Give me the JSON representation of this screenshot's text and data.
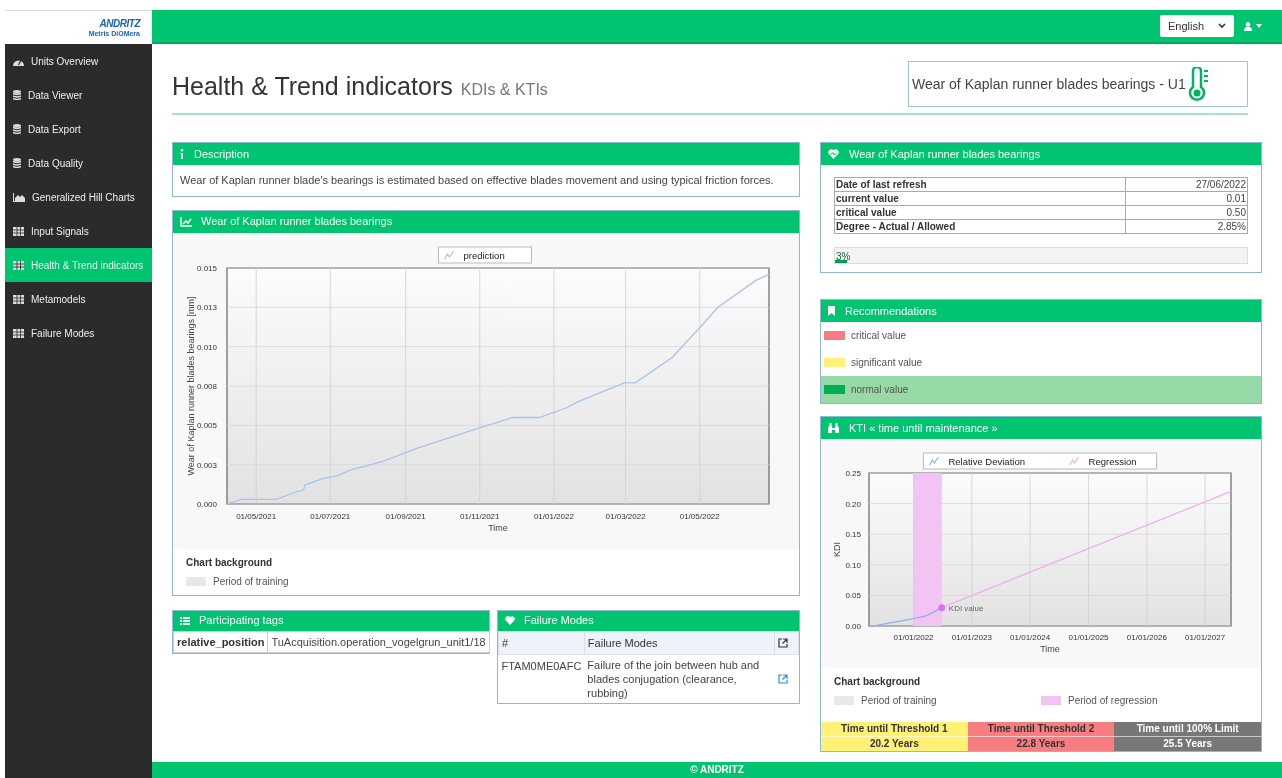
{
  "header": {
    "logo": {
      "brand": "ANDRITZ",
      "product": "Metris DiOMera"
    },
    "language": "English"
  },
  "sidebar": {
    "items": [
      {
        "label": "Units Overview",
        "kind": "gauge",
        "selected": false
      },
      {
        "label": "Data Viewer",
        "kind": "database",
        "selected": false
      },
      {
        "label": "Data Export",
        "kind": "database",
        "selected": false
      },
      {
        "label": "Data Quality",
        "kind": "database",
        "selected": false
      },
      {
        "label": "Generalized Hill Charts",
        "kind": "area-chart",
        "selected": false
      },
      {
        "label": "Input Signals",
        "kind": "table",
        "selected": false
      },
      {
        "label": "Health & Trend indicators",
        "kind": "table",
        "selected": true
      },
      {
        "label": "Metamodels",
        "kind": "table",
        "selected": false
      },
      {
        "label": "Failure Modes",
        "kind": "table",
        "selected": false
      }
    ]
  },
  "page": {
    "title": "Health & Trend indicators",
    "subtitle": "KDIs & KTIs",
    "indicator": "Wear of Kaplan runner blades bearings - U1"
  },
  "description": {
    "title": "Description",
    "text": "Wear of Kaplan runner blade's bearings is estimated based on effective blades movement and using typical friction forces."
  },
  "trend_chart": {
    "title": "Wear of Kaplan runner blades bearings",
    "chart_data": {
      "type": "line",
      "xlabel": "Time",
      "ylabel": "Wear of Kaplan runner blades bearings [mm]",
      "grid": true,
      "legend": "top",
      "x": [
        "2021-04-07",
        "2021-04-19",
        "2021-05-03",
        "2021-05-18",
        "2021-05-31",
        "2021-06-09",
        "2021-06-10",
        "2021-06-24",
        "2021-07-07",
        "2021-07-19",
        "2021-07-30",
        "2021-08-13",
        "2021-09-09",
        "2021-10-26",
        "2021-11-28",
        "2021-12-20",
        "2022-01-11",
        "2022-01-21",
        "2022-02-28",
        "2022-03-09",
        "2022-04-08",
        "2022-05-01",
        "2022-05-16",
        "2022-06-16",
        "2022-06-27"
      ],
      "series": [
        {
          "name": "prediction",
          "color": "#a8c2f0",
          "values": [
            0,
            0.0003,
            0.0003,
            0.0003,
            0.0007,
            0.0009,
            0.0012,
            0.0016,
            0.0018,
            0.0022,
            0.0024,
            0.0027,
            0.0035,
            0.0047,
            0.0055,
            0.0055,
            0.0061,
            0.0065,
            0.0077,
            0.0077,
            0.0093,
            0.0112,
            0.0125,
            0.0142,
            0.0146
          ]
        }
      ],
      "xlim": [
        "2021-04-07",
        "2022-06-27"
      ],
      "ylim": [
        0,
        0.015
      ],
      "xticks": [
        {
          "value": "2021-05-01",
          "label": "01/05/2021"
        },
        {
          "value": "2021-07-01",
          "label": "01/07/2021"
        },
        {
          "value": "2021-09-01",
          "label": "01/09/2021"
        },
        {
          "value": "2021-11-01",
          "label": "01/11/2021"
        },
        {
          "value": "2022-01-01",
          "label": "01/01/2022"
        },
        {
          "value": "2022-03-01",
          "label": "01/03/2022"
        },
        {
          "value": "2022-05-01",
          "label": "01/05/2022"
        }
      ],
      "yticks": [
        {
          "value": 0,
          "label": "0.000"
        },
        {
          "value": 0.0025,
          "label": "0.003"
        },
        {
          "value": 0.005,
          "label": "0.005"
        },
        {
          "value": 0.0075,
          "label": "0.008"
        },
        {
          "value": 0.01,
          "label": "0.010"
        },
        {
          "value": 0.0125,
          "label": "0.013"
        },
        {
          "value": 0.015,
          "label": "0.015"
        }
      ]
    },
    "background_legend": {
      "title": "Chart background",
      "items": [
        {
          "label": "Period of training",
          "color": "#e8e8e8"
        }
      ]
    }
  },
  "participating_tags": {
    "title": "Participating tags",
    "rows": [
      {
        "tag": "relative_position",
        "source": "TuAcquisition.operation_vogelgrun_unit1/18"
      }
    ]
  },
  "failure_modes": {
    "title": "Failure Modes",
    "columns": [
      "#",
      "Failure Modes"
    ],
    "rows": [
      {
        "code": "FTAM0ME0AFC",
        "description": "Failure of the join between hub and blades conjugation (clearance, rubbing)"
      }
    ]
  },
  "status": {
    "title": "Wear of Kaplan runner blades bearings",
    "rows": [
      {
        "label": "Date of last refresh",
        "value": "27/06/2022"
      },
      {
        "label": "current value",
        "value": "0.01"
      },
      {
        "label": "critical value",
        "value": "0.50"
      },
      {
        "label": "Degree - Actual / Allowed",
        "value": "2.85%"
      }
    ],
    "progress": {
      "level": 0.03,
      "label": "3%"
    }
  },
  "recommendations": {
    "title": "Recommendations",
    "items": [
      {
        "label": "critical value",
        "color": "#f47c82",
        "selected": false
      },
      {
        "label": "significant value",
        "color": "#fff17a",
        "selected": false
      },
      {
        "label": "normal value",
        "color": "#00b050",
        "selected": true
      }
    ]
  },
  "kti": {
    "title": "KTI « time until maintenance »",
    "chart_data": {
      "type": "line",
      "xlabel": "Time",
      "ylabel": "KDI",
      "grid": true,
      "legend": "top",
      "x": [
        "2021-03-28",
        "2021-05-15",
        "2022-01-01",
        "2022-03-25",
        "2022-06-27",
        "2027-06-12"
      ],
      "series": [
        {
          "name": "Relative Deviation",
          "color": "#8fb0f0",
          "values": [
            0,
            0.001,
            0.012,
            0.017,
            0.03,
            null
          ]
        },
        {
          "name": "Regression",
          "color": "#f0b0f0",
          "values": [
            null,
            null,
            null,
            null,
            0.03,
            0.22
          ]
        }
      ],
      "xlim": [
        "2021-03-28",
        "2027-06-12"
      ],
      "ylim": [
        0,
        0.25
      ],
      "xticks": [
        {
          "value": "2022-01-01",
          "label": "01/01/2022"
        },
        {
          "value": "2023-01-01",
          "label": "01/01/2023"
        },
        {
          "value": "2024-01-01",
          "label": "01/01/2024"
        },
        {
          "value": "2025-01-01",
          "label": "01/01/2025"
        },
        {
          "value": "2026-01-01",
          "label": "01/01/2026"
        },
        {
          "value": "2027-01-01",
          "label": "01/01/2027"
        }
      ],
      "yticks": [
        {
          "value": 0,
          "label": "0.00"
        },
        {
          "value": 0.05,
          "label": "0.05"
        },
        {
          "value": 0.1,
          "label": "0.10"
        },
        {
          "value": 0.15,
          "label": "0.15"
        },
        {
          "value": 0.2,
          "label": "0.20"
        },
        {
          "value": 0.25,
          "label": "0.25"
        }
      ],
      "annotations": [
        {
          "text": "KDI value",
          "x": "2022-06-27",
          "y": 0.03
        }
      ],
      "bands": [
        {
          "axis": "x",
          "from": "2022-01-01",
          "to": "2022-06-27",
          "color": "#f3c4f3"
        }
      ]
    },
    "background_legend": {
      "title": "Chart background",
      "items": [
        {
          "label": "Period of training",
          "color": "#e8e8e8"
        },
        {
          "label": "Period of regression",
          "color": "#f3c4f3"
        }
      ]
    },
    "thresholds": [
      {
        "label": "Time until Threshold 1",
        "value": "20.2 Years",
        "color": "#fff176"
      },
      {
        "label": "Time until Threshold 2",
        "value": "22.8 Years",
        "color": "#f77d80"
      },
      {
        "label": "Time until 100% Limit",
        "value": "25.5 Years",
        "color": "#777777"
      }
    ]
  },
  "footer": "© ANDRITZ"
}
